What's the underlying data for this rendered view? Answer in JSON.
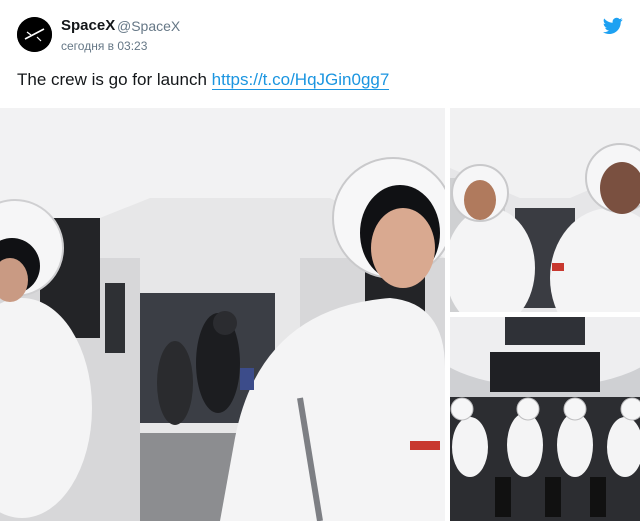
{
  "author": {
    "name": "SpaceX",
    "handle": "@SpaceX",
    "timestamp": "сегодня в 03:23",
    "avatar_icon": "spacex-logo-icon"
  },
  "tweet": {
    "text": "The crew is go for launch",
    "link": "https://t.co/HqJGin0gg7"
  },
  "colors": {
    "link": "#1b95e0",
    "twitter_blue": "#1da1f2",
    "name": "#14171a",
    "meta": "#657786"
  },
  "media": {
    "photos": [
      {
        "name": "crew-walking-photo"
      },
      {
        "name": "crew-helmets-photo"
      },
      {
        "name": "crew-seated-capsule-photo"
      }
    ]
  }
}
